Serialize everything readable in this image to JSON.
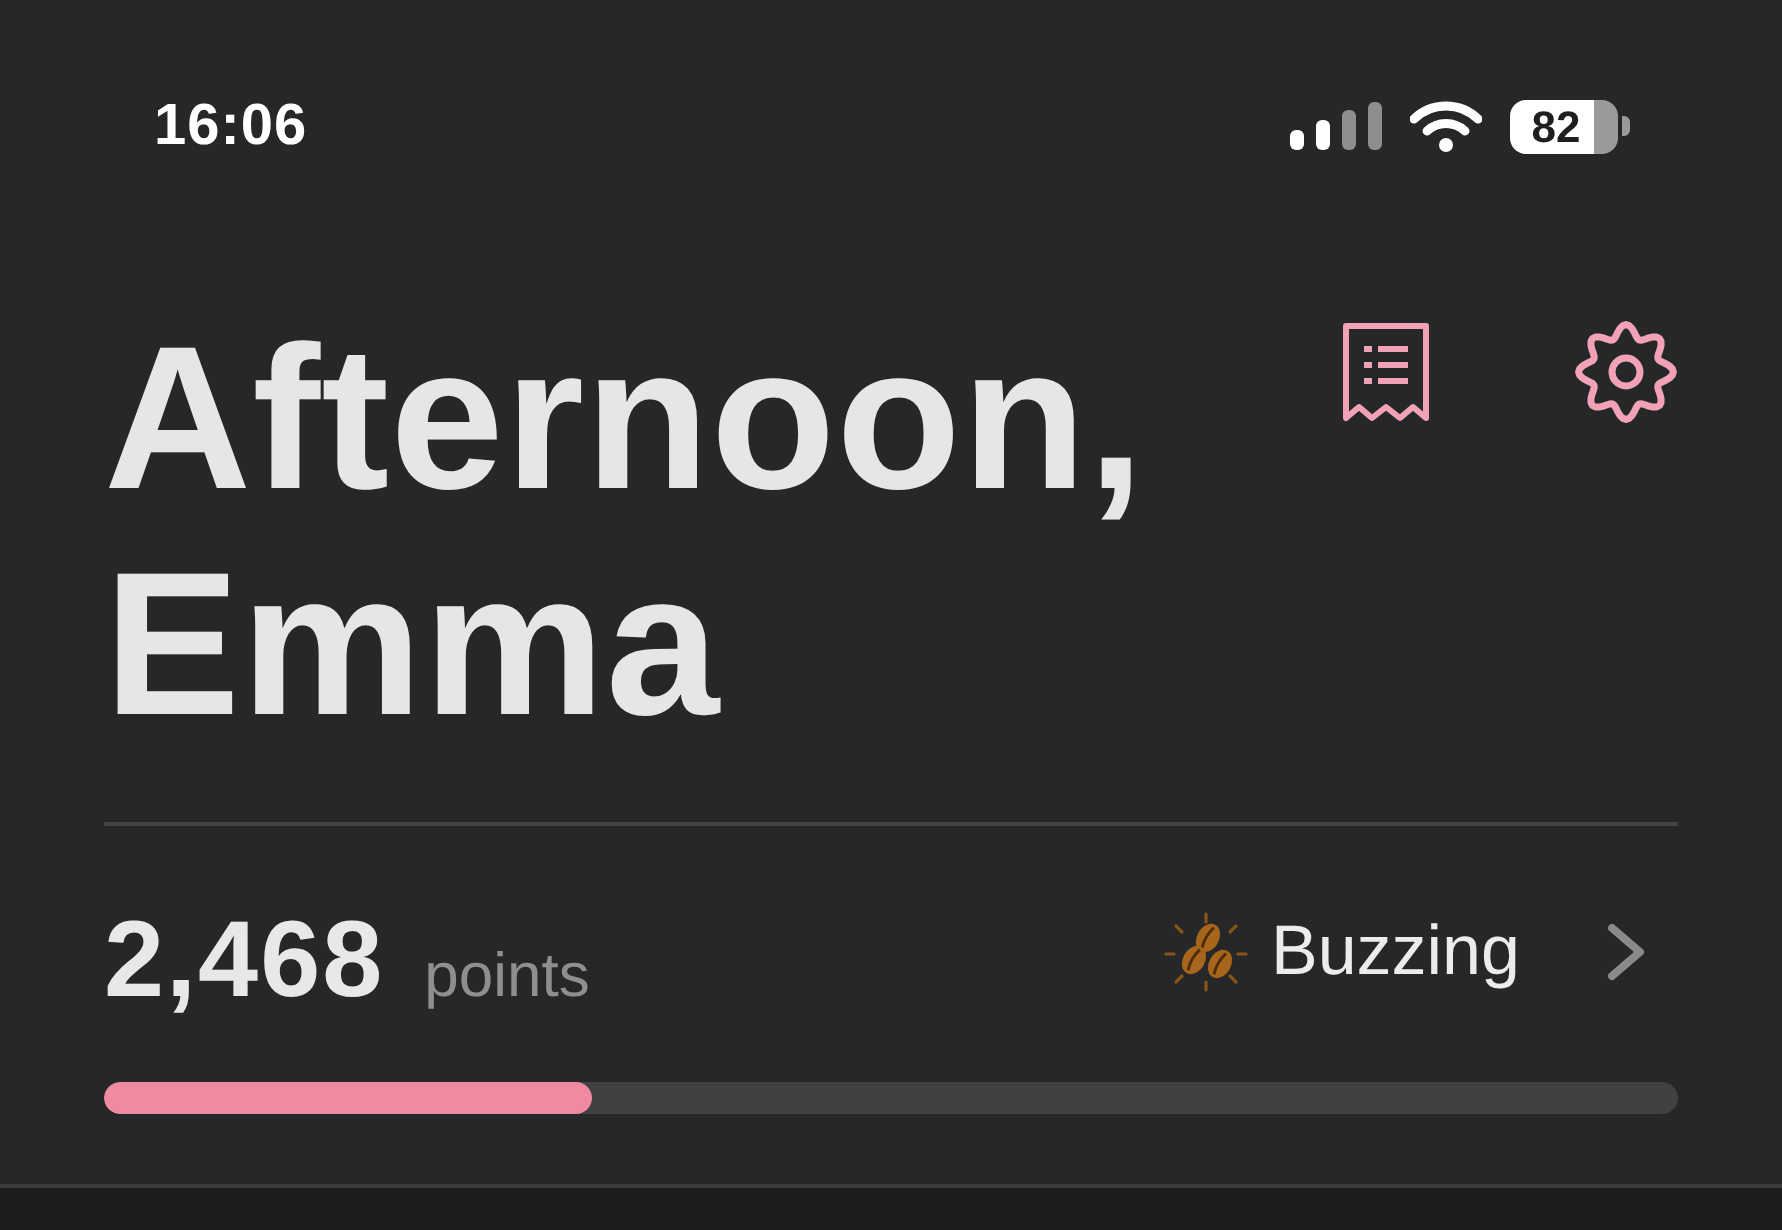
{
  "status_bar": {
    "time": "16:06",
    "battery": "82"
  },
  "header": {
    "greeting": "Afternoon, Emma"
  },
  "points": {
    "value": "2,468",
    "unit": "points"
  },
  "status": {
    "label": "Buzzing"
  },
  "progress": {
    "level": 0.31
  }
}
